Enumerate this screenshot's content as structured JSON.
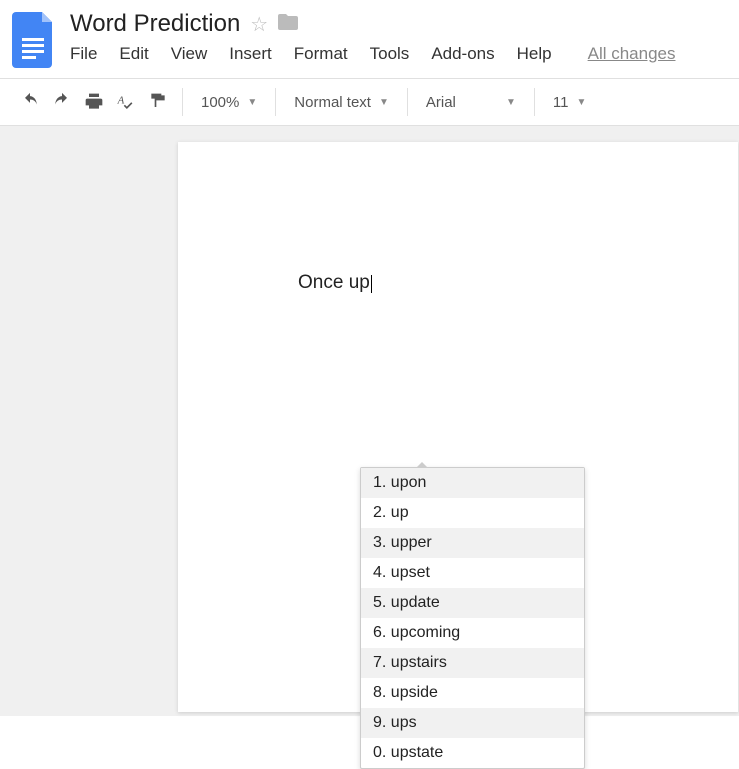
{
  "header": {
    "title": "Word Prediction",
    "all_changes": "All changes"
  },
  "menu": {
    "file": "File",
    "edit": "Edit",
    "view": "View",
    "insert": "Insert",
    "format": "Format",
    "tools": "Tools",
    "addons": "Add-ons",
    "help": "Help"
  },
  "toolbar": {
    "zoom": "100%",
    "style": "Normal text",
    "font": "Arial",
    "size": "11"
  },
  "document": {
    "text": "Once up"
  },
  "suggestions": {
    "items": [
      {
        "n": "1",
        "w": "upon"
      },
      {
        "n": "2",
        "w": "up"
      },
      {
        "n": "3",
        "w": "upper"
      },
      {
        "n": "4",
        "w": "upset"
      },
      {
        "n": "5",
        "w": "update"
      },
      {
        "n": "6",
        "w": "upcoming"
      },
      {
        "n": "7",
        "w": "upstairs"
      },
      {
        "n": "8",
        "w": "upside"
      },
      {
        "n": "9",
        "w": "ups"
      },
      {
        "n": "0",
        "w": "upstate"
      }
    ]
  }
}
